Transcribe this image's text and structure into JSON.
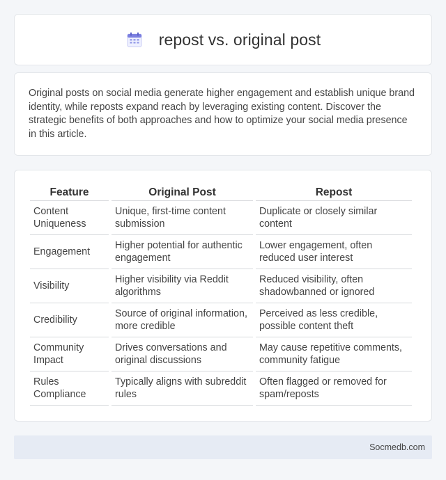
{
  "header": {
    "title": "repost vs. original post",
    "icon": "calendar-icon",
    "accent": "#7b7fe0"
  },
  "intro": {
    "text": "Original posts on social media generate higher engagement and establish unique brand identity, while reposts expand reach by leveraging existing content. Discover the strategic benefits of both approaches and how to optimize your social media presence in this article."
  },
  "table": {
    "headers": [
      "Feature",
      "Original Post",
      "Repost"
    ],
    "rows": [
      [
        "Content Uniqueness",
        "Unique, first-time content submission",
        "Duplicate or closely similar content"
      ],
      [
        "Engagement",
        "Higher potential for authentic engagement",
        "Lower engagement, often reduced user interest"
      ],
      [
        "Visibility",
        "Higher visibility via Reddit algorithms",
        "Reduced visibility, often shadowbanned or ignored"
      ],
      [
        "Credibility",
        "Source of original information, more credible",
        "Perceived as less credible, possible content theft"
      ],
      [
        "Community Impact",
        "Drives conversations and original discussions",
        "May cause repetitive comments, community fatigue"
      ],
      [
        "Rules Compliance",
        "Typically aligns with subreddit rules",
        "Often flagged or removed for spam/reposts"
      ]
    ]
  },
  "footer": {
    "site": "Socmedb.com"
  }
}
